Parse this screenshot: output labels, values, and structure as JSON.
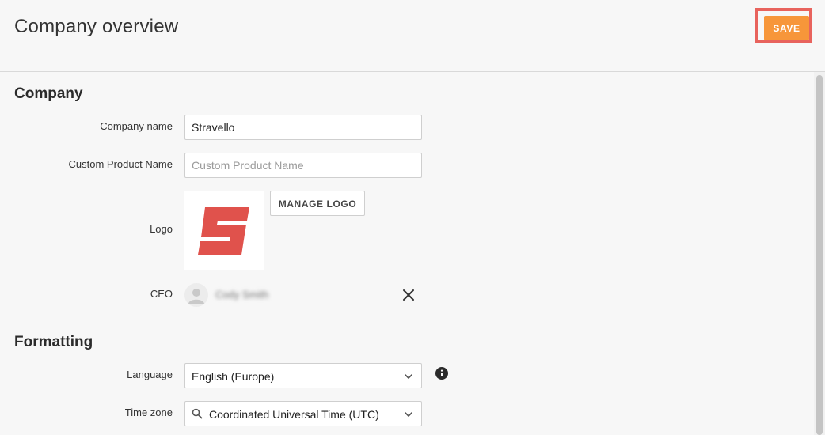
{
  "header": {
    "title": "Company overview",
    "save_label": "SAVE"
  },
  "company": {
    "section_title": "Company",
    "name_label": "Company name",
    "name_value": "Stravello",
    "custom_product_label": "Custom Product Name",
    "custom_product_value": "",
    "custom_product_placeholder": "Custom Product Name",
    "logo_label": "Logo",
    "manage_logo_label": "MANAGE LOGO",
    "ceo_label": "CEO",
    "ceo_name": "Cody Smith"
  },
  "formatting": {
    "section_title": "Formatting",
    "language_label": "Language",
    "language_value": "English (Europe)",
    "timezone_label": "Time zone",
    "timezone_value": "Coordinated Universal Time (UTC)"
  },
  "colors": {
    "accent": "#f7963a",
    "highlight": "#e8635d",
    "logo_red": "#e0524c"
  },
  "icons": {
    "logo": "stravello-s-logo",
    "avatar": "person-icon",
    "remove": "close-icon",
    "info": "info-icon",
    "chevron": "chevron-down-icon",
    "search": "search-icon"
  }
}
